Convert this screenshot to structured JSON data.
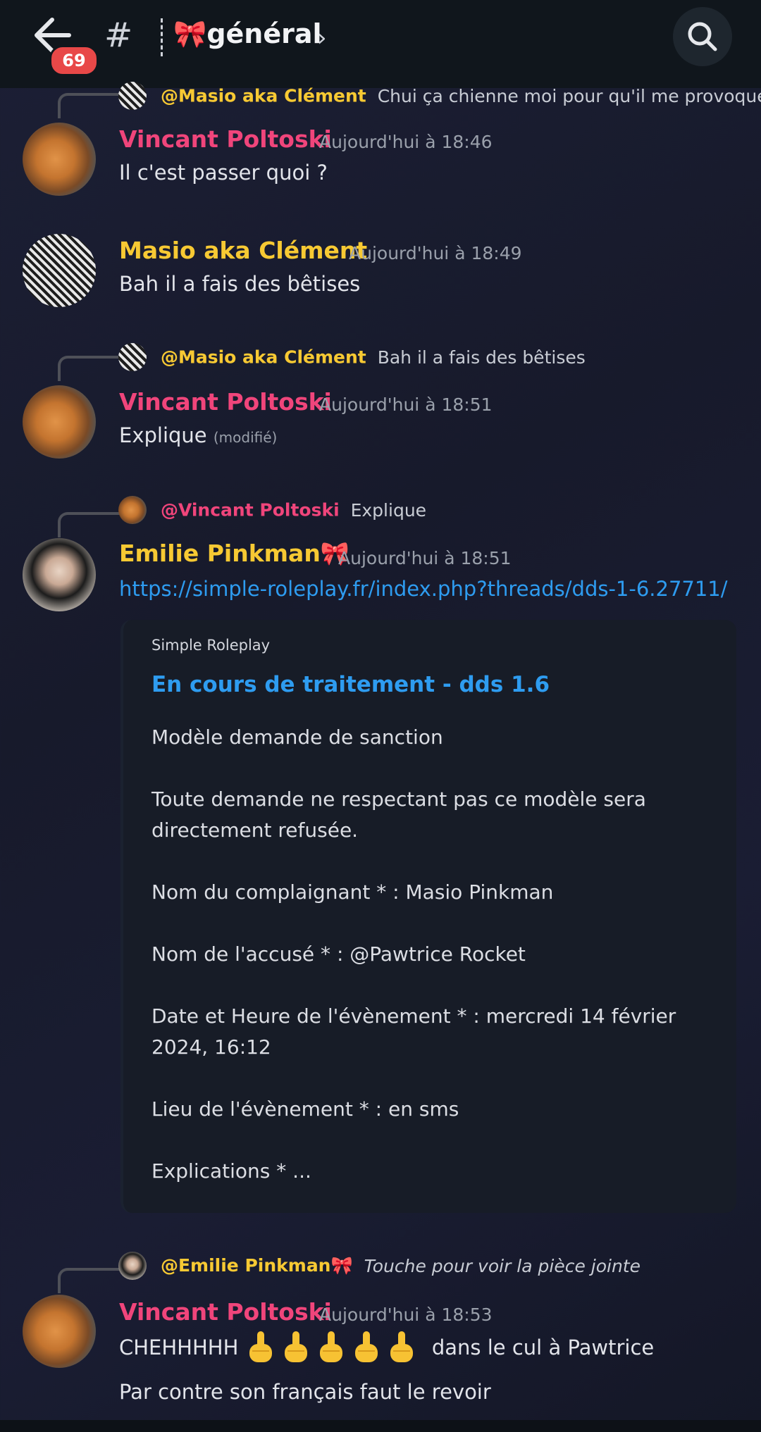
{
  "header": {
    "unread_count": "69",
    "hash": "#",
    "channel_name": "🎀général",
    "chevron": "›",
    "icons": {
      "back": "arrow-left-icon",
      "search": "search-icon"
    }
  },
  "messages": [
    {
      "reply_to": {
        "author": "@Masio aka Clément",
        "text": "Chui ça chienne moi pour qu'il me provoque ?"
      },
      "author": "Vincant Poltoski",
      "time": "Aujourd'hui à 18:46",
      "lines": [
        "Il c'est passer quoi ?"
      ]
    },
    {
      "author": "Masio aka Clément",
      "time": "Aujourd'hui à 18:49",
      "lines": [
        "Bah il a fais des bêtises"
      ]
    },
    {
      "reply_to": {
        "author": "@Masio aka Clément",
        "text": "Bah il a fais des bêtises"
      },
      "author": "Vincant Poltoski",
      "time": "Aujourd'hui à 18:51",
      "lines": [
        "Explique"
      ],
      "edited": "(modifié)"
    },
    {
      "reply_to": {
        "author": "@Vincant Poltoski",
        "text": "Explique"
      },
      "author": "Emilie Pinkman🎀",
      "time": "Aujourd'hui à 18:51",
      "link": "https://simple-roleplay.fr/index.php?threads/dds-1-6.27711/",
      "embed": {
        "provider": "Simple Roleplay",
        "title": "En cours de traitement - dds 1.6",
        "lines": [
          "Modèle demande de sanction",
          "Toute demande ne respectant pas ce modèle sera",
          "directement refusée.",
          "Nom du complaignant * : Masio Pinkman",
          "Nom de l'accusé * : @Pawtrice Rocket",
          "Date et Heure de l'évènement * : mercredi 14 février",
          "2024, 16:12",
          "Lieu de l'évènement * : en sms",
          "Explications * ..."
        ]
      }
    },
    {
      "reply_to": {
        "author": "@Emilie Pinkman🎀",
        "text": "Touche pour voir la pièce jointe"
      },
      "author": "Vincant Poltoski",
      "time": "Aujourd'hui à 18:53",
      "lines": [
        "CHEHHHHH",
        "dans le cul à Pawtrice",
        "Par contre son français faut le revoir"
      ],
      "emoji": "middle-finger-emoji"
    }
  ],
  "colors": {
    "pink_name": "#f0457b",
    "yellow_name": "#f7c933",
    "link": "#2e9cf0",
    "badge": "#e84848"
  }
}
